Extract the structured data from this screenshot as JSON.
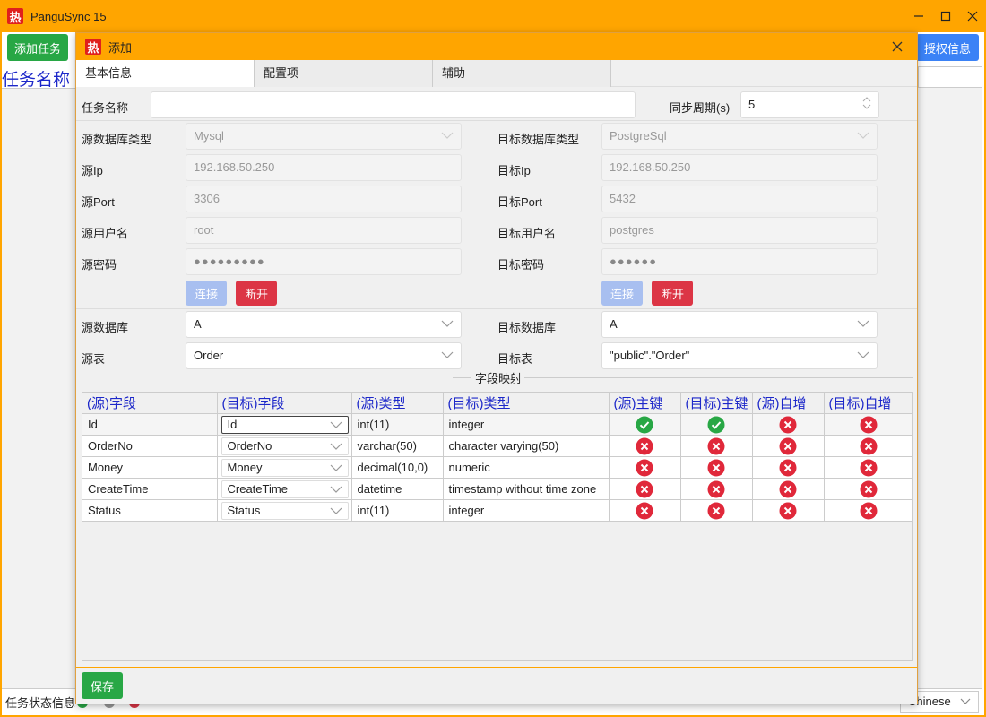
{
  "app": {
    "title": "PanguSync 15",
    "logo_char": "热"
  },
  "toolbar": {
    "add_task_label": "添加任务",
    "license_label": "授权信息"
  },
  "task_list": {
    "name_header": "任务名称"
  },
  "statusbar": {
    "status_label": "任务状态信息",
    "language": "Chinese",
    "colors": {
      "running": "#28a745",
      "stopped": "#999999",
      "error": "#dc3545"
    }
  },
  "dialog": {
    "title": "添加",
    "logo_char": "热",
    "tabs": [
      {
        "label": "基本信息"
      },
      {
        "label": "配置项"
      },
      {
        "label": "辅助"
      }
    ],
    "task_name": {
      "label": "任务名称",
      "value": ""
    },
    "sync_period": {
      "label": "同步周期(s)",
      "value": "5"
    },
    "source": {
      "db_type": {
        "label": "源数据库类型",
        "value": "Mysql"
      },
      "ip": {
        "label": "源Ip",
        "value": "192.168.50.250"
      },
      "port": {
        "label": "源Port",
        "value": "3306"
      },
      "user": {
        "label": "源用户名",
        "value": "root"
      },
      "password": {
        "label": "源密码",
        "value": "●●●●●●●●●"
      },
      "connect_label": "连接",
      "disconnect_label": "断开",
      "database": {
        "label": "源数据库",
        "value": "A"
      },
      "table": {
        "label": "源表",
        "value": "Order"
      }
    },
    "target": {
      "db_type": {
        "label": "目标数据库类型",
        "value": "PostgreSql"
      },
      "ip": {
        "label": "目标Ip",
        "value": "192.168.50.250"
      },
      "port": {
        "label": "目标Port",
        "value": "5432"
      },
      "user": {
        "label": "目标用户名",
        "value": "postgres"
      },
      "password": {
        "label": "目标密码",
        "value": "●●●●●●"
      },
      "connect_label": "连接",
      "disconnect_label": "断开",
      "database": {
        "label": "目标数据库",
        "value": "A"
      },
      "table": {
        "label": "目标表",
        "value": "\"public\".\"Order\""
      }
    },
    "mapping": {
      "title": "字段映射",
      "headers": [
        "(源)字段",
        "(目标)字段",
        "(源)类型",
        "(目标)类型",
        "(源)主键",
        "(目标)主键",
        "(源)自增",
        "(目标)自增"
      ],
      "rows": [
        {
          "src_field": "Id",
          "tgt_field": "Id",
          "src_type": "int(11)",
          "tgt_type": "integer",
          "src_pk": true,
          "tgt_pk": true,
          "src_ai": false,
          "tgt_ai": false
        },
        {
          "src_field": "OrderNo",
          "tgt_field": "OrderNo",
          "src_type": "varchar(50)",
          "tgt_type": "character varying(50)",
          "src_pk": false,
          "tgt_pk": false,
          "src_ai": false,
          "tgt_ai": false
        },
        {
          "src_field": "Money",
          "tgt_field": "Money",
          "src_type": "decimal(10,0)",
          "tgt_type": "numeric",
          "src_pk": false,
          "tgt_pk": false,
          "src_ai": false,
          "tgt_ai": false
        },
        {
          "src_field": "CreateTime",
          "tgt_field": "CreateTime",
          "src_type": "datetime",
          "tgt_type": "timestamp without time zone",
          "src_pk": false,
          "tgt_pk": false,
          "src_ai": false,
          "tgt_ai": false
        },
        {
          "src_field": "Status",
          "tgt_field": "Status",
          "src_type": "int(11)",
          "tgt_type": "integer",
          "src_pk": false,
          "tgt_pk": false,
          "src_ai": false,
          "tgt_ai": false
        }
      ]
    },
    "save_label": "保存"
  },
  "colors": {
    "accent": "#FFA500",
    "success": "#28a745",
    "danger": "#dc3545",
    "primary": "#3b82f6",
    "header_text": "#1c27c9"
  }
}
